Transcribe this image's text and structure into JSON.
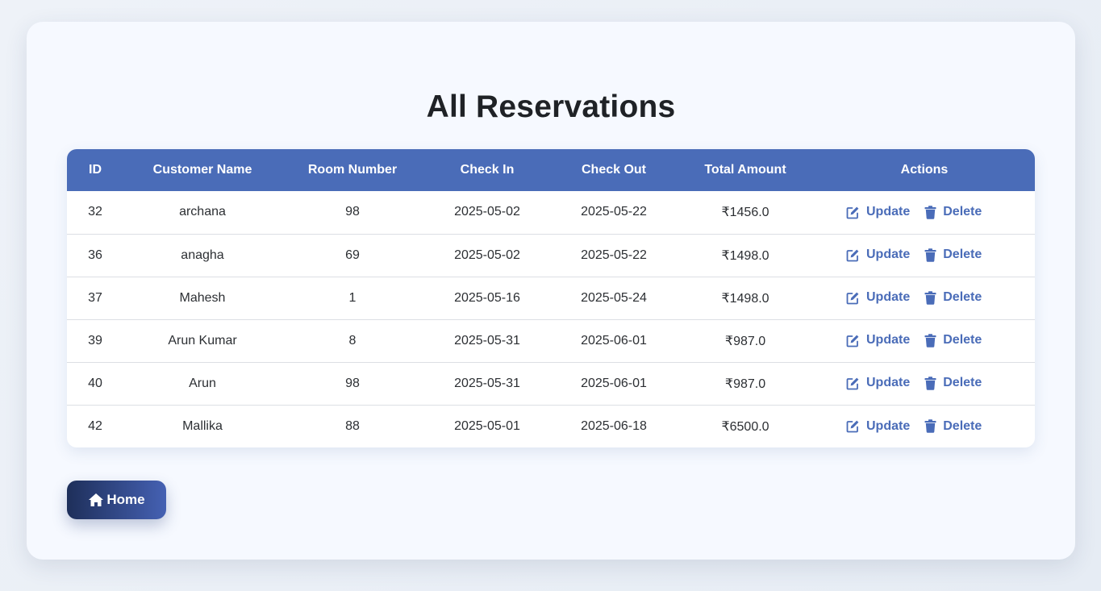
{
  "page": {
    "title": "All Reservations"
  },
  "table": {
    "columns": [
      "ID",
      "Customer Name",
      "Room Number",
      "Check In",
      "Check Out",
      "Total Amount",
      "Actions"
    ],
    "rows": [
      {
        "id": "32",
        "customer_name": "archana",
        "room_number": "98",
        "check_in": "2025-05-02",
        "check_out": "2025-05-22",
        "total_amount": "₹1456.0"
      },
      {
        "id": "36",
        "customer_name": "anagha",
        "room_number": "69",
        "check_in": "2025-05-02",
        "check_out": "2025-05-22",
        "total_amount": "₹1498.0"
      },
      {
        "id": "37",
        "customer_name": "Mahesh",
        "room_number": "1",
        "check_in": "2025-05-16",
        "check_out": "2025-05-24",
        "total_amount": "₹1498.0"
      },
      {
        "id": "39",
        "customer_name": "Arun Kumar",
        "room_number": "8",
        "check_in": "2025-05-31",
        "check_out": "2025-06-01",
        "total_amount": "₹987.0"
      },
      {
        "id": "40",
        "customer_name": "Arun",
        "room_number": "98",
        "check_in": "2025-05-31",
        "check_out": "2025-06-01",
        "total_amount": "₹987.0"
      },
      {
        "id": "42",
        "customer_name": "Mallika",
        "room_number": "88",
        "check_in": "2025-05-01",
        "check_out": "2025-06-18",
        "total_amount": "₹6500.0"
      }
    ],
    "actions": {
      "update_label": "Update",
      "update_icon": "edit-icon",
      "delete_label": "Delete",
      "delete_icon": "trash-icon"
    }
  },
  "home_button": {
    "label": "Home",
    "icon": "home-icon"
  },
  "colors": {
    "accent": "#4a6cb8",
    "header_bg": "#4a6cb8",
    "title_text": "#1f2226",
    "home_gradient_start": "#1e2f5a",
    "home_gradient_end": "#4561b3"
  }
}
